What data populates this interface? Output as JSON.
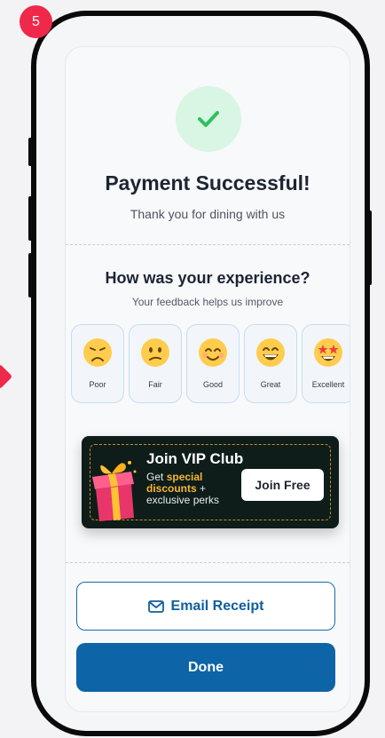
{
  "step": {
    "number": "5",
    "color": "#f0284a"
  },
  "status": {
    "icon": "check-icon",
    "title": "Payment Successful!",
    "subtitle": "Thank you for dining with us",
    "accent": "#2fbf5f"
  },
  "feedback": {
    "question": "How was your experience?",
    "hint": "Your feedback helps us improve",
    "options": [
      {
        "label": "Poor",
        "icon": "disappointed-face-icon"
      },
      {
        "label": "Fair",
        "icon": "confused-face-icon"
      },
      {
        "label": "Good",
        "icon": "smiling-face-icon"
      },
      {
        "label": "Great",
        "icon": "grinning-face-icon"
      },
      {
        "label": "Excellent",
        "icon": "star-struck-face-icon"
      }
    ]
  },
  "vip": {
    "title": "Join VIP Club",
    "text_prefix": "Get ",
    "highlight": "special discounts",
    "text_suffix": " + exclusive perks",
    "cta": "Join Free",
    "icon": "gift-icon"
  },
  "actions": {
    "email_label": "Email Receipt",
    "email_icon": "mail-icon",
    "done_label": "Done",
    "primary_color": "#0d64a7"
  }
}
